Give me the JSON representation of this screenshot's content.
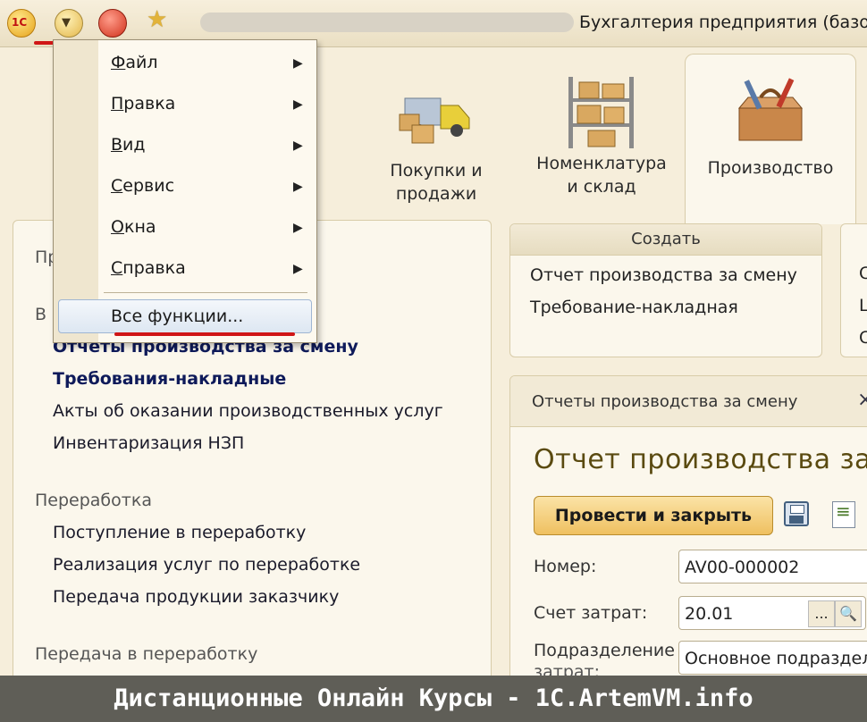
{
  "titlebar": {
    "logo_text": "1С",
    "app_title": "Бухгалтерия предприятия (базо"
  },
  "sections": [
    {
      "label_1": "Покупки и",
      "label_2": "продажи",
      "icon": "truck-boxes-icon"
    },
    {
      "label_1": "Номенклатура",
      "label_2": "и склад",
      "icon": "warehouse-shelves-icon"
    },
    {
      "label_1": "Производство",
      "icon": "toolbox-icon"
    }
  ],
  "left_panel": {
    "partial_top": "Пр",
    "partial_group": "В",
    "items_main": [
      "Отчеты производства за смену",
      "Требования-накладные",
      "Акты об оказании производственных услуг",
      "Инвентаризация НЗП"
    ],
    "group_processing": "Переработка",
    "items_processing": [
      "Поступление в переработку",
      "Реализация услуг по переработке",
      "Передача продукции заказчику"
    ],
    "group_transfer": "Передача в переработку"
  },
  "create_panel": {
    "title": "Создать",
    "items": [
      "Отчет производства за смену",
      "Требование-накладная"
    ]
  },
  "right_stub": {
    "chars": [
      "С",
      "Ц",
      "С"
    ]
  },
  "document": {
    "tab_label": "Отчеты производства за смену",
    "tab_close": "×",
    "title": "Отчет производства за",
    "post_close_button": "Провести и закрыть",
    "fields": {
      "number_label": "Номер:",
      "number_value": "AV00-000002",
      "account_label": "Счет затрат:",
      "account_value": "20.01",
      "dept_label": "Подразделение",
      "dept_label_2": "затрат:",
      "dept_value": "Основное подраздел",
      "select_btn": "...",
      "search_btn": "🔍"
    }
  },
  "menu": {
    "items": [
      {
        "hot": "Ф",
        "rest": "айл"
      },
      {
        "hot": "П",
        "rest": "равка"
      },
      {
        "hot": "В",
        "rest": "ид"
      },
      {
        "hot": "С",
        "rest": "ервис"
      },
      {
        "hot": "О",
        "rest": "кна"
      },
      {
        "hot": "С",
        "rest": "правка"
      }
    ],
    "arrow": "▶",
    "all_functions": "Все функции..."
  },
  "footer": {
    "text": "Дистанционные Онлайн Курсы - 1C.ArtemVM.info"
  }
}
